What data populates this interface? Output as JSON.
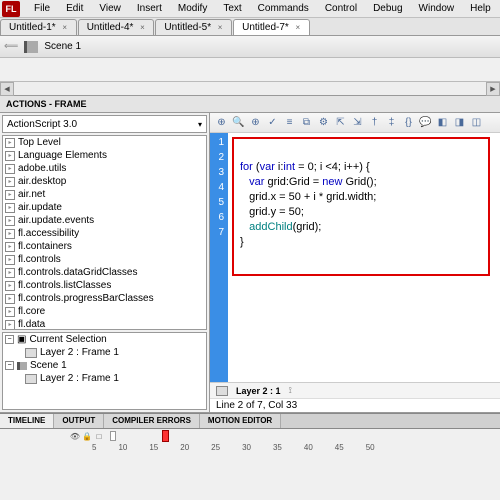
{
  "menu": [
    "File",
    "Edit",
    "View",
    "Insert",
    "Modify",
    "Text",
    "Commands",
    "Control",
    "Debug",
    "Window",
    "Help"
  ],
  "tabs": [
    {
      "label": "Untitled-1*",
      "active": false
    },
    {
      "label": "Untitled-4*",
      "active": false
    },
    {
      "label": "Untitled-5*",
      "active": false
    },
    {
      "label": "Untitled-7*",
      "active": true
    }
  ],
  "scene": {
    "label": "Scene 1"
  },
  "actions": {
    "panel_title": "ACTIONS - FRAME",
    "language": "ActionScript 3.0",
    "packages": [
      "Top Level",
      "Language Elements",
      "adobe.utils",
      "air.desktop",
      "air.net",
      "air.update",
      "air.update.events",
      "fl.accessibility",
      "fl.containers",
      "fl.controls",
      "fl.controls.dataGridClasses",
      "fl.controls.listClasses",
      "fl.controls.progressBarClasses",
      "fl.core",
      "fl.data"
    ],
    "selection": {
      "current_label": "Current Selection",
      "current_item": "Layer 2 : Frame 1",
      "scene_label": "Scene 1",
      "scene_item": "Layer 2 : Frame 1"
    }
  },
  "code": {
    "gutter": [
      1,
      2,
      3,
      4,
      5,
      6,
      7
    ],
    "lines": [
      {
        "plain": ""
      },
      {
        "frag": [
          {
            "t": "for",
            "c": "kw"
          },
          {
            "t": " ("
          },
          {
            "t": "var",
            "c": "kw"
          },
          {
            "t": " i:"
          },
          {
            "t": "int",
            "c": "kw"
          },
          {
            "t": " = 0; i <4; i++) {"
          }
        ]
      },
      {
        "indent": "   ",
        "frag": [
          {
            "t": "var",
            "c": "kw"
          },
          {
            "t": " grid:Grid = "
          },
          {
            "t": "new",
            "c": "kw"
          },
          {
            "t": " Grid();"
          }
        ]
      },
      {
        "indent": "   ",
        "frag": [
          {
            "t": "grid.x = 50 + i * grid.width;"
          }
        ]
      },
      {
        "indent": "   ",
        "frag": [
          {
            "t": "grid.y = 50;"
          }
        ]
      },
      {
        "indent": "   ",
        "frag": [
          {
            "t": "addChild",
            "c": "fn"
          },
          {
            "t": "(grid);"
          }
        ]
      },
      {
        "frag": [
          {
            "t": "}"
          }
        ]
      }
    ],
    "layer_label": "Layer 2 : 1",
    "cursor_info": "Line 2 of 7, Col 33"
  },
  "bottom_tabs": [
    "TIMELINE",
    "OUTPUT",
    "COMPILER ERRORS",
    "MOTION EDITOR"
  ],
  "timeline": {
    "marks": [
      5,
      10,
      15,
      20,
      25,
      30,
      35,
      40,
      45,
      50
    ]
  }
}
